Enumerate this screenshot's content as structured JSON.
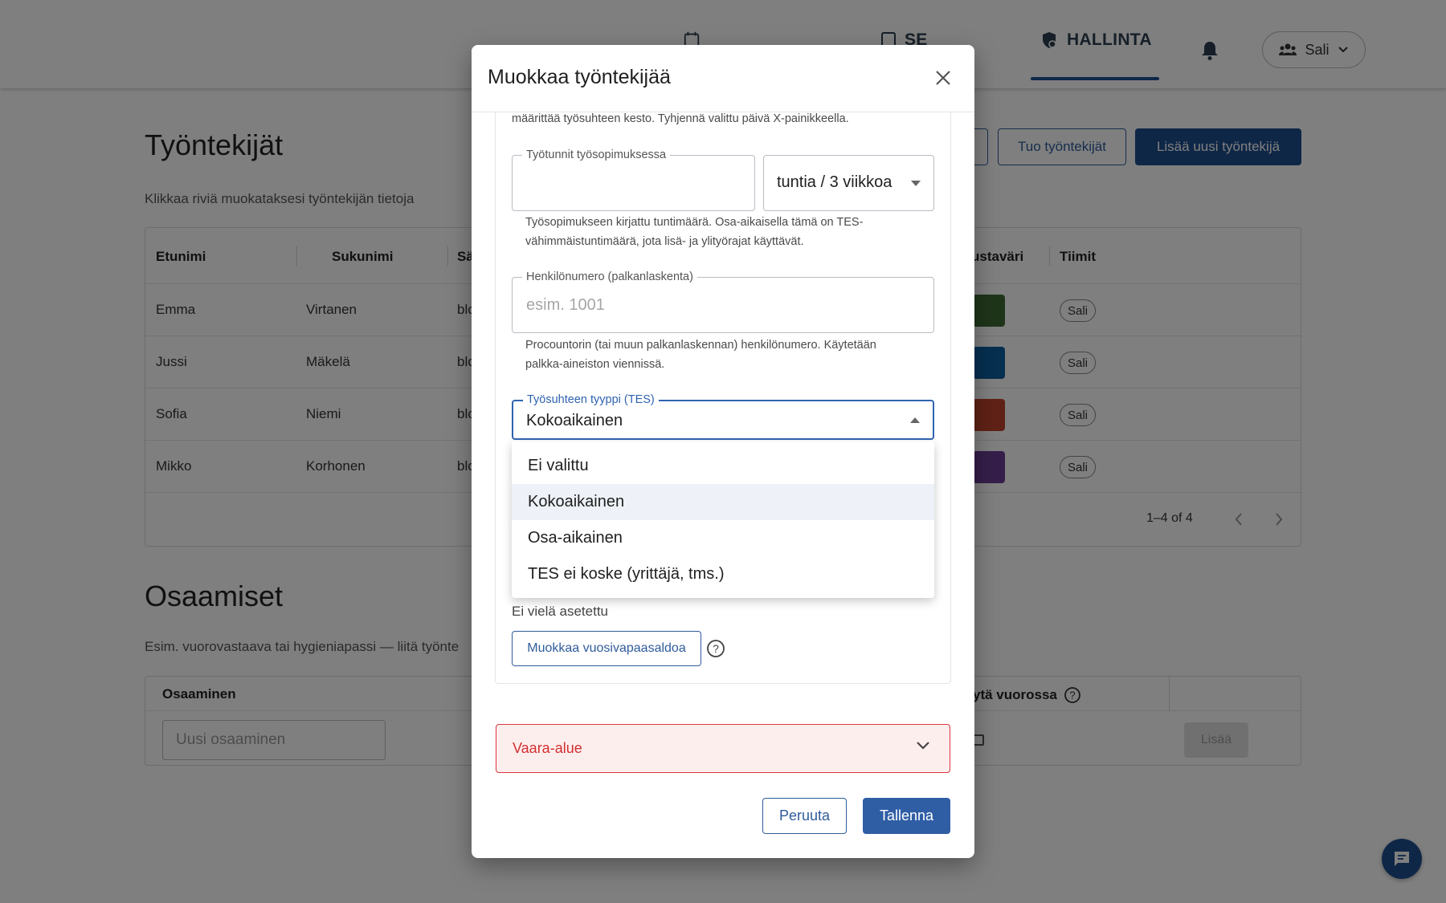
{
  "nav": {
    "items": [
      {
        "label": ""
      },
      {
        "label": "SE"
      },
      {
        "label": "HALLINTA"
      }
    ],
    "user_label": "Sali"
  },
  "page": {
    "title": "Työntekijät",
    "subtitle": "Klikkaa riviä muokataksesi työntekijän tietoja",
    "import_button": "Tuo työntekijät",
    "add_button": "Lisää uusi työntekijä"
  },
  "table": {
    "headers": [
      "Etunimi",
      "Sukunimi",
      "Sä",
      "ustaväri",
      "Tiimit"
    ],
    "rows": [
      {
        "first": "Emma",
        "last": "Virtanen",
        "email": "blo",
        "color": "#3f6a35",
        "team": "Sali"
      },
      {
        "first": "Jussi",
        "last": "Mäkelä",
        "email": "blo",
        "color": "#0d5fa0",
        "team": "Sali"
      },
      {
        "first": "Sofia",
        "last": "Niemi",
        "email": "blo",
        "color": "#c0442d",
        "team": "Sali"
      },
      {
        "first": "Mikko",
        "last": "Korhonen",
        "email": "blo",
        "color": "#6a3f94",
        "team": "Sali"
      }
    ],
    "pagination": "1–4 of 4"
  },
  "skills": {
    "title": "Osaamiset",
    "subtitle": "Esim. vuorovastaava tai hygieniapassi — liitä työnte",
    "header_skill": "Osaaminen",
    "header_required": "ytä vuorossa",
    "input_placeholder": "Uusi osaaminen",
    "add_button": "Lisää"
  },
  "modal": {
    "title": "Muokkaa työntekijää",
    "top_helper": "määrittää työsuhteen kesto. Tyhjennä valittu päivä X-painikkeella.",
    "hours_label": "Työtunnit työsopimuksessa",
    "hours_value": "",
    "hours_unit": "tuntia / 3 viikkoa",
    "hours_helper_1": "Työsopimukseen kirjattu tuntimäärä. Osa-aikaisella tämä on TES-",
    "hours_helper_2": "vähimmäistuntimäärä, jota lisä- ja ylityörajat käyttävät.",
    "personnel_label": "Henkilönumero (palkanlaskenta)",
    "personnel_placeholder": "esim. 1001",
    "personnel_helper_1": "Procountorin (tai muun palkanlaskennan) henkilönumero. Käytetään",
    "personnel_helper_2": "palkka-aineiston viennissä.",
    "employment_label": "Työsuhteen tyyppi (TES)",
    "employment_value": "Kokoaikainen",
    "employment_options": [
      "Ei valittu",
      "Kokoaikainen",
      "Osa-aikainen",
      "TES ei koske (yrittäjä, tms.)"
    ],
    "employment_selected_index": 1,
    "vacation_status": "Ei vielä asetettu",
    "edit_vacation_button": "Muokkaa vuosivapaasaldoa",
    "danger_zone": "Vaara-alue",
    "cancel_button": "Peruuta",
    "save_button": "Tallenna"
  },
  "colors": {
    "primary": "#1f4f8f",
    "focus": "#2f63b0",
    "danger": "#d32f2f",
    "danger_bg": "#fdeeee"
  }
}
